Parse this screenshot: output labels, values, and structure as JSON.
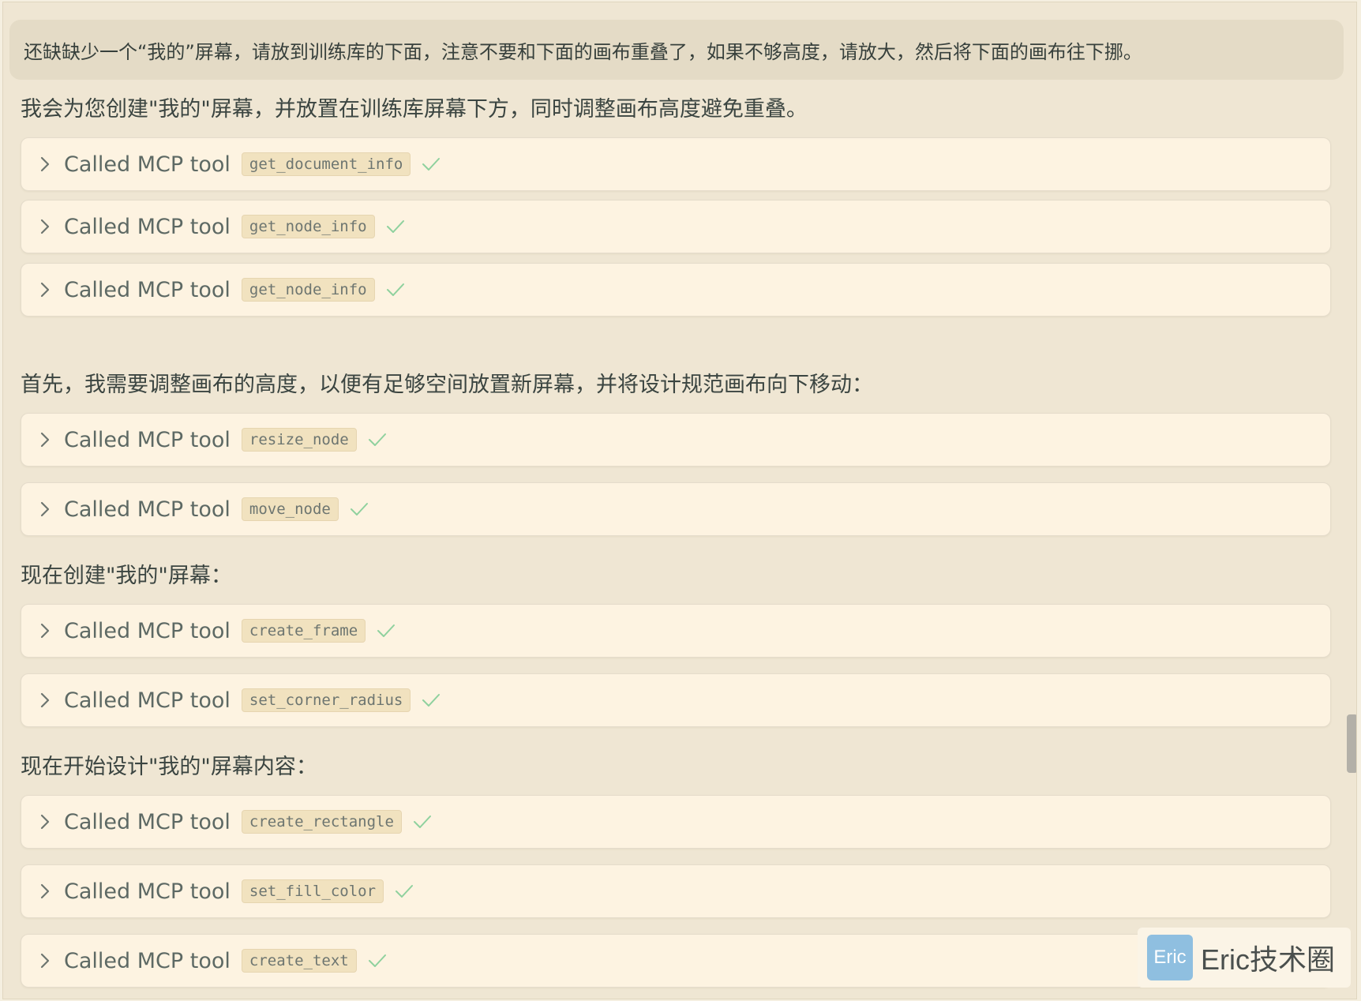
{
  "user_message": "还缺缺少一个“我的”屏幕，请放到训练库的下面，注意不要和下面的画布重叠了，如果不够高度，请放大，然后将下面的画布往下挪。",
  "blocks": [
    {
      "kind": "text",
      "text": "我会为您创建\"我的\"屏幕，并放置在训练库屏幕下方，同时调整画布高度避免重叠。"
    },
    {
      "kind": "tool",
      "label": "Called MCP tool",
      "name": "get_document_info",
      "status": "done"
    },
    {
      "kind": "tool",
      "label": "Called MCP tool",
      "name": "get_node_info",
      "status": "done"
    },
    {
      "kind": "tool",
      "label": "Called MCP tool",
      "name": "get_node_info",
      "status": "done"
    },
    {
      "kind": "text",
      "text": "首先，我需要调整画布的高度，以便有足够空间放置新屏幕，并将设计规范画布向下移动："
    },
    {
      "kind": "tool",
      "label": "Called MCP tool",
      "name": "resize_node",
      "status": "done"
    },
    {
      "kind": "tool",
      "label": "Called MCP tool",
      "name": "move_node",
      "status": "done"
    },
    {
      "kind": "text",
      "text": "现在创建\"我的\"屏幕："
    },
    {
      "kind": "tool",
      "label": "Called MCP tool",
      "name": "create_frame",
      "status": "done"
    },
    {
      "kind": "tool",
      "label": "Called MCP tool",
      "name": "set_corner_radius",
      "status": "done"
    },
    {
      "kind": "text",
      "text": "现在开始设计\"我的\"屏幕内容："
    },
    {
      "kind": "tool",
      "label": "Called MCP tool",
      "name": "create_rectangle",
      "status": "done"
    },
    {
      "kind": "tool",
      "label": "Called MCP tool",
      "name": "set_fill_color",
      "status": "done"
    },
    {
      "kind": "tool",
      "label": "Called MCP tool",
      "name": "create_text",
      "status": "done"
    }
  ],
  "watermark": {
    "badge": "Eric",
    "text": "Eric技术圈"
  },
  "icons": {
    "expand": "chevron-right-icon",
    "status": "check-icon"
  },
  "colors": {
    "background": "#efe6d3",
    "card": "#fdf3e1",
    "check": "#8fd19e",
    "chip": "#f1e2bf"
  }
}
